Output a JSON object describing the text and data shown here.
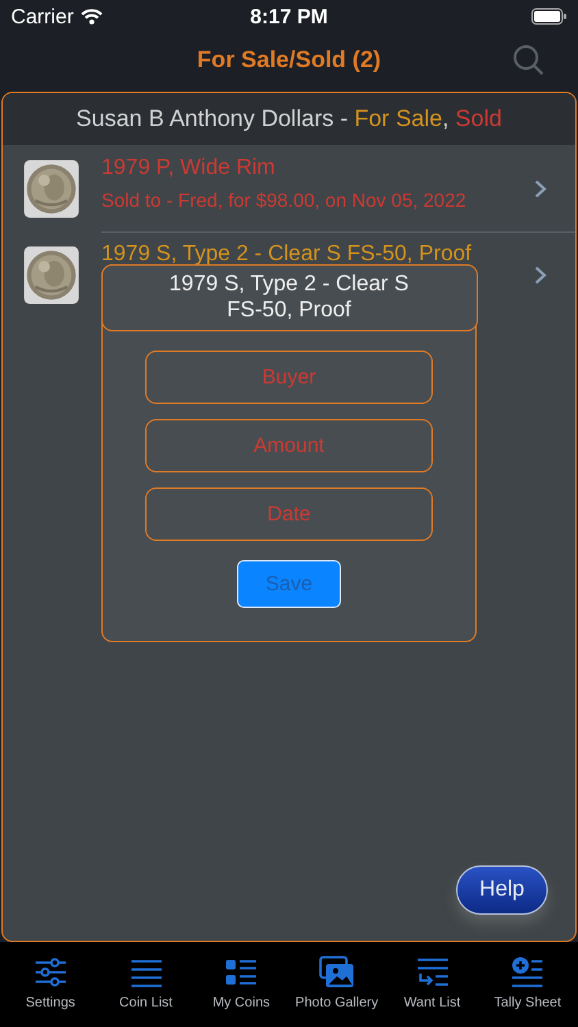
{
  "status_bar": {
    "carrier": "Carrier",
    "time": "8:17 PM"
  },
  "nav": {
    "title": "For Sale/Sold (2)"
  },
  "header": {
    "parts": [
      {
        "text": "Susan B Anthony Dollars - ",
        "color": "#d2d2d2"
      },
      {
        "text": "For Sale",
        "color": "#d4921e"
      },
      {
        "separator": ", ",
        "text": "Sold",
        "color": "#cc3a33"
      }
    ]
  },
  "rows": [
    {
      "title": "1979 P, Wide Rim",
      "subtitle": "Sold to - Fred, for $98.00, on Nov 05, 2022",
      "color": "#cc3a33"
    },
    {
      "title": "1979 S, Type 2 - Clear S FS-50, Proof",
      "color": "#d4921e"
    }
  ],
  "dialog": {
    "title_lines": [
      "1979 S, Type 2 - Clear S",
      "FS-50, Proof"
    ],
    "fields": [
      {
        "placeholder": "Buyer"
      },
      {
        "placeholder": "Amount"
      },
      {
        "placeholder": "Date"
      }
    ],
    "save": {
      "label": "Save",
      "disabled": true
    }
  },
  "help_button": "Help",
  "tabs": [
    {
      "kind": "settings",
      "label": "Settings"
    },
    {
      "kind": "list",
      "label": "Coin List"
    },
    {
      "kind": "mycoins",
      "label": "My Coins"
    },
    {
      "kind": "gallery",
      "label": "Photo Gallery"
    },
    {
      "kind": "want",
      "label": "Want List"
    },
    {
      "kind": "tally",
      "label": "Tally Sheet"
    }
  ]
}
